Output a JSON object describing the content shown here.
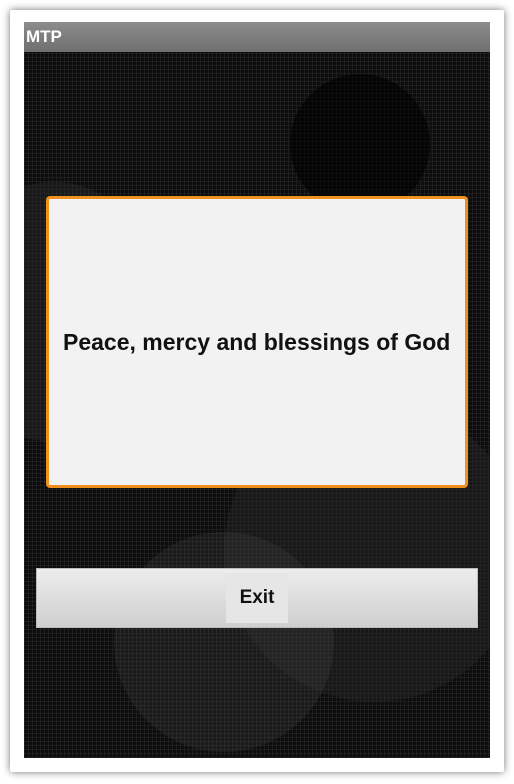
{
  "app": {
    "title": "MTP"
  },
  "message": {
    "text": "Peace, mercy and blessings of God"
  },
  "actions": {
    "exit_label": "Exit"
  },
  "colors": {
    "card_border": "#f0901e",
    "title_bar": "#7a7a7a",
    "background": "#0d0d0d"
  }
}
